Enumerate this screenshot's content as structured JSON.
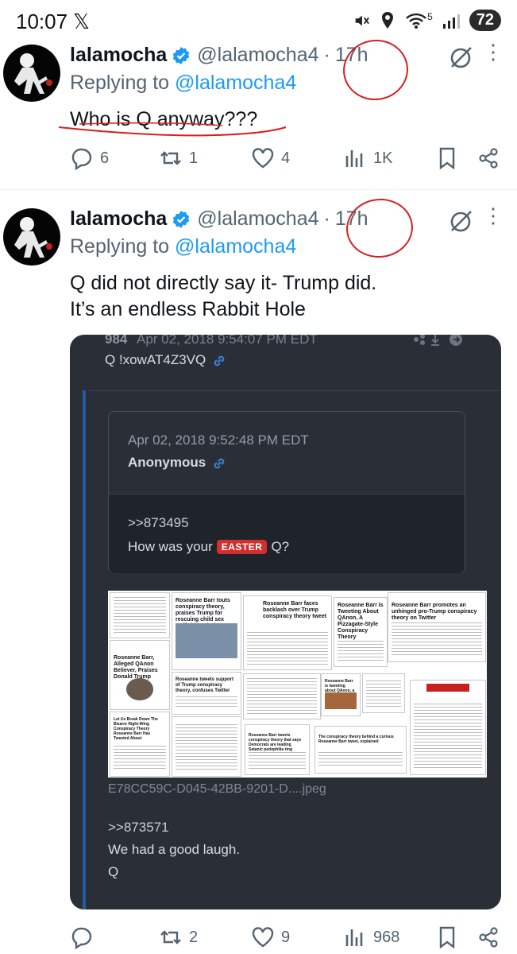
{
  "status_bar": {
    "time": "10:07",
    "x_logo": "𝕏",
    "battery": "72",
    "network": "5"
  },
  "colors": {
    "link": "#1d9bf0",
    "muted": "#536471",
    "verified": "#1d9bf0",
    "annotation_red": "#d42020",
    "card_bg": "#2a2f37",
    "easter_badge": "#d32f2f"
  },
  "tweets": [
    {
      "name": "lalamocha",
      "handle": "@lalamocha4",
      "dot": "·",
      "time": "17h",
      "replying_prefix": "Replying to ",
      "replying_handle": "@lalamocha4",
      "text_lines": [
        "Who is Q anyway???"
      ],
      "actions": {
        "replies": "6",
        "reposts": "1",
        "likes": "4",
        "views": "1K"
      }
    },
    {
      "name": "lalamocha",
      "handle": "@lalamocha4",
      "dot": "·",
      "time": "17h",
      "replying_prefix": "Replying to ",
      "replying_handle": "@lalamocha4",
      "text_lines": [
        "Q did not directly say it- Trump did.",
        "It’s an endless Rabbit Hole"
      ],
      "actions": {
        "replies": "",
        "reposts": "2",
        "likes": "9",
        "views": "968"
      }
    }
  ],
  "image_card": {
    "post_number": "984",
    "post_date": "Apr 02, 2018 9:54:07 PM EDT",
    "poster_id": "Q !xowAT4Z3VQ",
    "quoted": {
      "date": "Apr 02, 2018 9:52:48 PM EDT",
      "name": "Anonymous",
      "ref": ">>873495",
      "text_before": "How was your",
      "badge": "EASTER",
      "text_after": "Q?"
    },
    "collage_headlines": [
      "Roseanne Barr touts conspiracy theory, praises Trump for rescuing child sex trafficking victims",
      "Roseanne Barr faces backlash over Trump conspiracy theory tweet",
      "Roseanne Barr Is Tweeting About QAnon, A Pizzagate-Style Conspiracy Theory",
      "Roseanne Barr promotes an unhinged pro-Trump conspiracy theory on Twitter",
      "Roseanne Barr, Alleged QAnon Believer, Praises Donald Trump",
      "Roseanne tweets support of Trump conspiracy theory, confuses Twitter",
      "Roseanne Barr is tweeting about QAnon, a new Pizzagate-style conspiracy theory",
      "Let Us Break Down The Bizarre Right-Wing Conspiracy Theory Roseanne Barr Has Tweeted About",
      "Roseanne Barr tweets conspiracy theory that says Democrats are leading Satanic pedophilia ring",
      "The conspiracy theory behind a curious Roseanne Barr tweet, explained"
    ],
    "filename": "E78CC59C-D045-42BB-9201-D....jpeg",
    "reply_ref": ">>873571",
    "reply_text": "We had a good laugh.",
    "signature": "Q"
  }
}
